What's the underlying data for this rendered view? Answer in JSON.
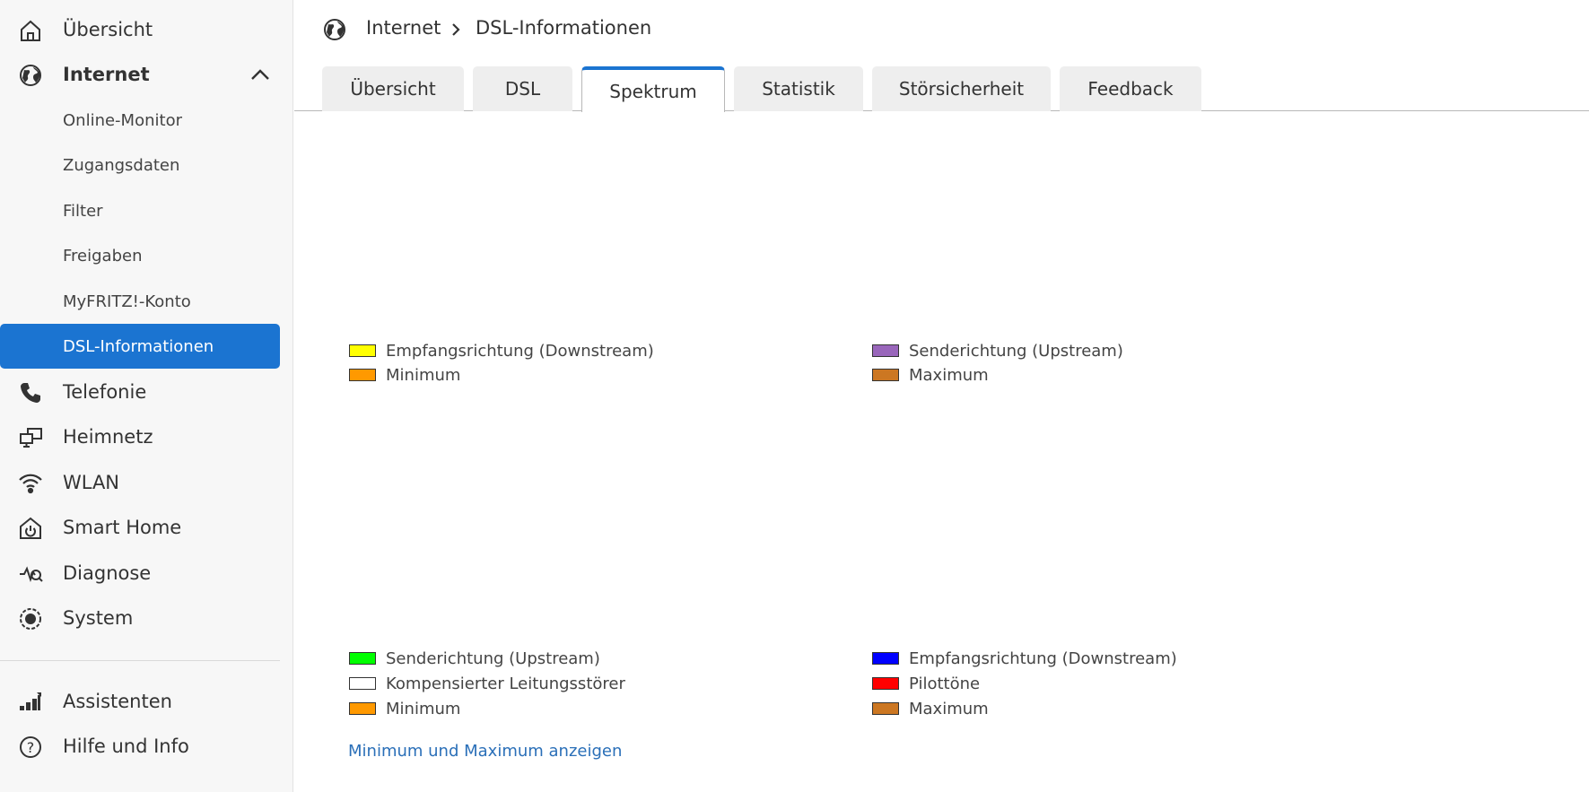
{
  "sidebar": {
    "items": [
      {
        "label": "Übersicht",
        "icon": "home-icon",
        "type": "main"
      },
      {
        "label": "Internet",
        "icon": "globe-icon",
        "type": "main",
        "expanded": true
      },
      {
        "label": "Online-Monitor",
        "type": "sub"
      },
      {
        "label": "Zugangsdaten",
        "type": "sub"
      },
      {
        "label": "Filter",
        "type": "sub"
      },
      {
        "label": "Freigaben",
        "type": "sub"
      },
      {
        "label": "MyFRITZ!-Konto",
        "type": "sub"
      },
      {
        "label": "DSL-Informationen",
        "type": "sub",
        "active": true
      },
      {
        "label": "Telefonie",
        "icon": "phone-icon",
        "type": "main"
      },
      {
        "label": "Heimnetz",
        "icon": "network-icon",
        "type": "main"
      },
      {
        "label": "WLAN",
        "icon": "wifi-icon",
        "type": "main"
      },
      {
        "label": "Smart Home",
        "icon": "smart-home-icon",
        "type": "main"
      },
      {
        "label": "Diagnose",
        "icon": "diagnose-icon",
        "type": "main"
      },
      {
        "label": "System",
        "icon": "system-icon",
        "type": "main"
      }
    ],
    "bottom_items": [
      {
        "label": "Assistenten",
        "icon": "assistant-icon"
      },
      {
        "label": "Hilfe und Info",
        "icon": "help-icon"
      }
    ],
    "active_color": "#1b74d1"
  },
  "breadcrumb": {
    "level1": "Internet",
    "level2": "DSL-Informationen"
  },
  "tabs": [
    {
      "label": "Übersicht"
    },
    {
      "label": "DSL"
    },
    {
      "label": "Spektrum",
      "active": true
    },
    {
      "label": "Statistik"
    },
    {
      "label": "Störsicherheit"
    },
    {
      "label": "Feedback"
    }
  ],
  "legend_top": [
    {
      "label": "Empfangsrichtung (Downstream)",
      "color": "#ffff00"
    },
    {
      "label": "Minimum",
      "color": "#ff9900"
    },
    {
      "label": "Senderichtung (Upstream)",
      "color": "#9966bb"
    },
    {
      "label": "Maximum",
      "color": "#cc7722"
    }
  ],
  "legend_bottom": [
    {
      "label": "Senderichtung (Upstream)",
      "color": "#00ff00"
    },
    {
      "label": "Kompensierter Leitungsstörer",
      "color": "#ffffff"
    },
    {
      "label": "Minimum",
      "color": "#ff9900"
    },
    {
      "label": "Empfangsrichtung (Downstream)",
      "color": "#0000ff"
    },
    {
      "label": "Pilottöne",
      "color": "#ff0000"
    },
    {
      "label": "Maximum",
      "color": "#cc7722"
    }
  ],
  "toggle_link": "Minimum und Maximum anzeigen"
}
